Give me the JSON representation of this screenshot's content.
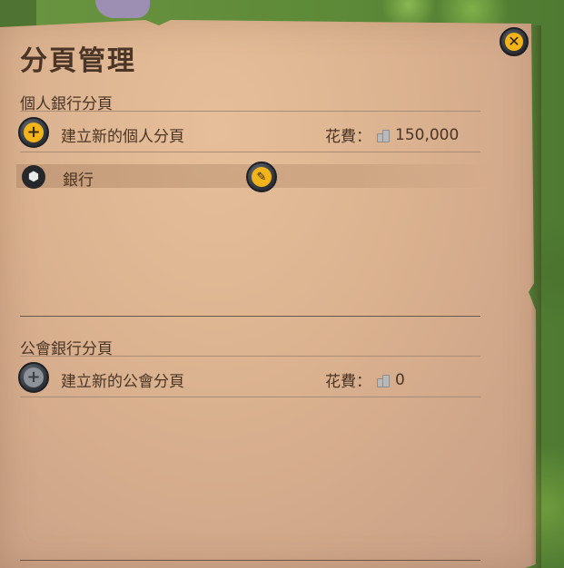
{
  "dialog": {
    "title": "分頁管理",
    "close_icon": "close-icon"
  },
  "personal_section": {
    "title": "個人銀行分頁",
    "create_label": "建立新的個人分頁",
    "cost_label": "花費：",
    "cost_value": "150,000",
    "tabs": [
      {
        "label": "銀行",
        "icon": "bank-cube-icon",
        "edit_icon": "edit-icon"
      }
    ]
  },
  "guild_section": {
    "title": "公會銀行分頁",
    "create_label": "建立新的公會分頁",
    "cost_label": "花費：",
    "cost_value": "0"
  },
  "colors": {
    "accent": "#f2b418",
    "text": "#4a3526",
    "panel": "#dcb390"
  }
}
